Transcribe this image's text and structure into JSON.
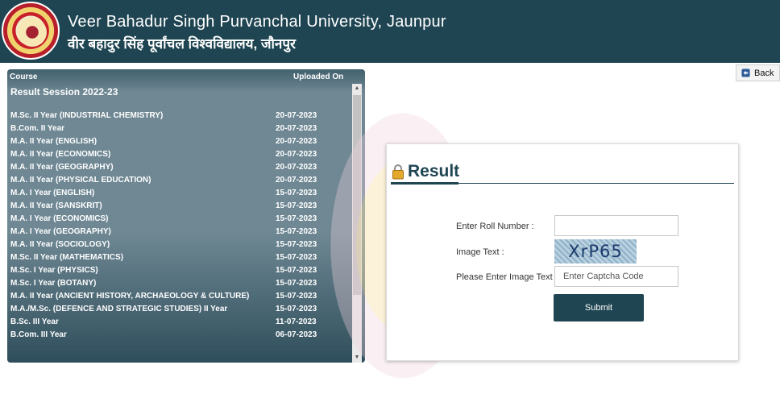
{
  "header": {
    "title_en": "Veer Bahadur Singh Purvanchal University, Jaunpur",
    "title_hi": "वीर बहादुर सिंह पूर्वांचल विश्वविद्यालय, जौनपुर"
  },
  "back_label": "Back",
  "results_list": {
    "col_course": "Course",
    "col_uploaded": "Uploaded On",
    "session": "Result Session 2022-23",
    "rows": [
      {
        "course": "M.Sc. II Year (INDUSTRIAL CHEMISTRY)",
        "date": "20-07-2023"
      },
      {
        "course": "B.Com. II Year",
        "date": "20-07-2023"
      },
      {
        "course": "M.A. II Year (ENGLISH)",
        "date": "20-07-2023"
      },
      {
        "course": "M.A. II Year (ECONOMICS)",
        "date": "20-07-2023"
      },
      {
        "course": "M.A. II Year (GEOGRAPHY)",
        "date": "20-07-2023"
      },
      {
        "course": "M.A. II Year (PHYSICAL EDUCATION)",
        "date": "20-07-2023"
      },
      {
        "course": "M.A. I Year (ENGLISH)",
        "date": "15-07-2023"
      },
      {
        "course": "M.A. II Year (SANSKRIT)",
        "date": "15-07-2023"
      },
      {
        "course": "M.A. I Year (ECONOMICS)",
        "date": "15-07-2023"
      },
      {
        "course": "M.A. I Year (GEOGRAPHY)",
        "date": "15-07-2023"
      },
      {
        "course": "M.A. II Year (SOCIOLOGY)",
        "date": "15-07-2023"
      },
      {
        "course": "M.Sc. II Year (MATHEMATICS)",
        "date": "15-07-2023"
      },
      {
        "course": "M.Sc. I Year (PHYSICS)",
        "date": "15-07-2023"
      },
      {
        "course": "M.Sc. I Year (BOTANY)",
        "date": "15-07-2023"
      },
      {
        "course": "M.A. II Year (ANCIENT HISTORY, ARCHAEOLOGY & CULTURE)",
        "date": "15-07-2023"
      },
      {
        "course": "M.A./M.Sc. (DEFENCE AND STRATEGIC STUDIES) II Year",
        "date": "15-07-2023"
      },
      {
        "course": "B.Sc. III Year",
        "date": "11-07-2023"
      },
      {
        "course": "B.Com. III Year",
        "date": "06-07-2023"
      }
    ]
  },
  "form": {
    "title": "Result",
    "roll_label": "Enter Roll Number :",
    "roll_value": "",
    "image_label": "Image Text :",
    "captcha_text": "XrP65",
    "captcha_label": "Please Enter Image Text :",
    "captcha_placeholder": "Enter Captcha Code",
    "submit_label": "Submit"
  },
  "icons": {
    "logo": "university-logo",
    "back": "back-arrow-icon",
    "lock": "lock-icon"
  },
  "colors": {
    "primary": "#1f4552"
  }
}
